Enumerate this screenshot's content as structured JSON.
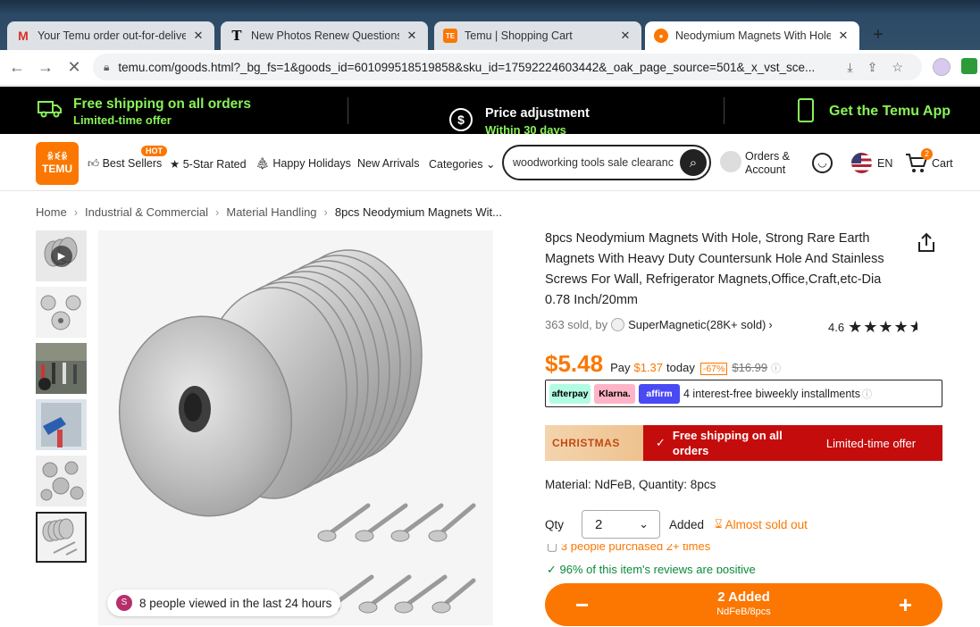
{
  "browser": {
    "tabs": [
      {
        "title": "Your Temu order out-for-deliver",
        "icon": "gmail-icon",
        "active": false
      },
      {
        "title": "New Photos Renew Questions A",
        "icon": "nyt-icon",
        "active": false
      },
      {
        "title": "Temu | Shopping Cart",
        "icon": "temu-icon",
        "active": false
      },
      {
        "title": "Neodymium Magnets With Hole",
        "icon": "temu-icon",
        "active": true
      }
    ],
    "new_tab": "+",
    "url": "temu.com/goods.html?_bg_fs=1&goods_id=601099518519858&sku_id=17592224603442&_oak_page_source=501&_x_vst_sce..."
  },
  "promo": {
    "shipping_title": "Free shipping on all orders",
    "shipping_sub": "Limited-time offer",
    "price_title": "Price adjustment",
    "price_sub": "Within 30 days",
    "app": "Get the Temu App"
  },
  "header": {
    "logo_top": "ꆜꀥꆜ",
    "logo_text": "TEMU",
    "hot_badge": "HOT",
    "nav": {
      "best_sellers": "Best Sellers",
      "five_star": "5-Star Rated",
      "holidays": "Happy Holidays",
      "new_arrivals": "New Arrivals",
      "categories": "Categories"
    },
    "search_value": "woodworking tools sale clearance",
    "orders_line1": "Orders &",
    "orders_line2": "Account",
    "lang": "EN",
    "cart_label": "Cart",
    "cart_count": "2"
  },
  "breadcrumb": [
    "Home",
    "Industrial & Commercial",
    "Material Handling",
    "8pcs Neodymium Magnets Wit..."
  ],
  "product": {
    "title": "8pcs Neodymium Magnets With Hole, Strong Rare Earth Magnets With Heavy Duty Countersunk Hole And Stainless Screws For Wall, Refrigerator Magnets,Office,Craft,etc-Dia 0.78 Inch/20mm",
    "sold": "363 sold, by",
    "seller": "SuperMagnetic(28K+ sold)",
    "rating": "4.6",
    "rating_value": 4.6,
    "price": "$5.48",
    "pay_label": "Pay",
    "pay_today": "$1.37",
    "today_label": "today",
    "discount": "-67%",
    "orig_price": "$16.99",
    "bnpl_text": "4 interest-free biweekly installments",
    "afterpay": "afterpay",
    "klarna": "Klarna.",
    "affirm": "affirm",
    "xmas_label": "CHRISTMAS",
    "free_ship": "Free shipping on all orders",
    "limited": "Limited-time offer",
    "material": "Material: NdFeB, Quantity: 8pcs",
    "qty_label": "Qty",
    "qty_value": "2",
    "added_label": "Added",
    "almost": "Almost sold out",
    "people_purchased": "3 people purchased 2+ times",
    "reviews_positive": "96% of this item's reviews are positive",
    "viewed_avatar": "S",
    "viewed": "8 people viewed in the last 24 hours",
    "cart_added": "2 Added",
    "cart_variant": "NdFeB/8pcs"
  },
  "colors": {
    "accent": "#fb7701",
    "promo_green": "#8af25a",
    "xmas_red": "#c50c0c"
  }
}
